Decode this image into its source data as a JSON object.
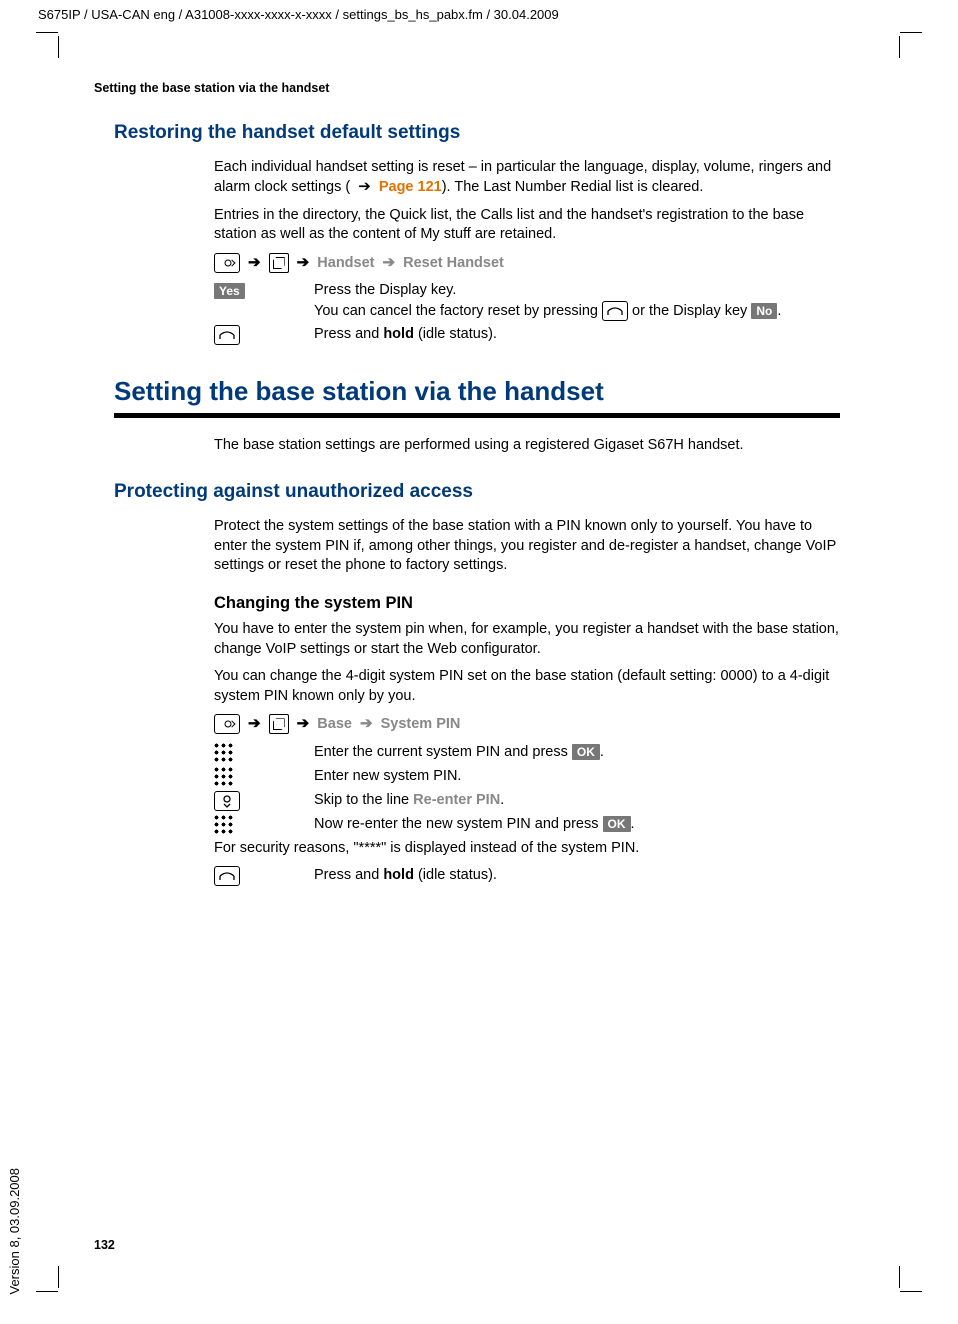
{
  "header_path": "S675IP  / USA-CAN eng / A31008-xxxx-xxxx-x-xxxx / settings_bs_hs_pabx.fm / 30.04.2009",
  "version": "Version 8, 03.09.2008",
  "running_title": "Setting the base station via the handset",
  "page_number": "132",
  "sec1": {
    "title": "Restoring the handset default settings",
    "p1a": "Each individual handset setting is reset – in particular the language, display, volume, ringers and alarm clock settings ( ",
    "page_ref": "Page 121",
    "p1b": "). The Last Number Redial list is cleared.",
    "p2": "Entries in the directory, the Quick list, the Calls list and the handset's registration to the base station as well as the content of My stuff are retained.",
    "menu_handset": "Handset",
    "menu_reset": "Reset Handset",
    "yes_key": "Yes",
    "yes_line1": "Press the Display key.",
    "yes_line2a": "You can cancel the factory reset by pressing ",
    "yes_line2b": " or the Display key ",
    "no_key": "No",
    "hold_line_a": "Press and ",
    "hold_bold": "hold",
    "hold_line_b": " (idle status)."
  },
  "sec2": {
    "title": "Setting the base station via the handset",
    "intro": "The base station settings are performed using a registered Gigaset S67H handset."
  },
  "sec3": {
    "title": "Protecting against unauthorized access",
    "p1": "Protect the system settings of the base station with a PIN known only to yourself. You have to enter the system PIN if, among other things, you register and de-register a handset, change VoIP settings or reset the phone to factory settings."
  },
  "sec4": {
    "title": "Changing the system PIN",
    "p1": "You have to enter the system pin when, for example, you register a handset with the base station, change VoIP settings or start the Web configurator.",
    "p2": "You can change the 4-digit system PIN set on the base station (default setting: 0000) to a 4-digit system PIN known only by you.",
    "menu_base": "Base",
    "menu_syspin": "System PIN",
    "r1a": "Enter the current system PIN and press ",
    "ok_key": "OK",
    "r2": "Enter new system PIN.",
    "r3a": "Skip to the line ",
    "r3b": "Re-enter PIN",
    "r4a": "Now re-enter the new system PIN and press ",
    "security": "For security reasons, \"****\" is displayed instead of the system PIN.",
    "hold_line_a": "Press and ",
    "hold_bold": "hold",
    "hold_line_b": " (idle status)."
  }
}
